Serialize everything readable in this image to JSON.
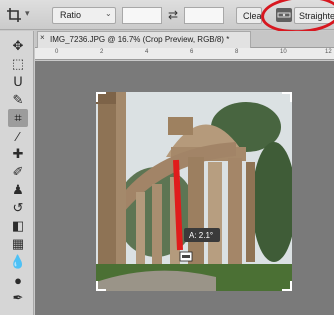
{
  "options_bar": {
    "tool_icon": "crop-icon",
    "ratio_label": "Ratio",
    "swap_icon": "swap-arrows-icon",
    "clear_label": "Clear",
    "straighten_icon": "level-icon",
    "straighten_label": "Straighten",
    "highlight_color": "#d7171f"
  },
  "toolbar": {
    "items": [
      {
        "name": "move-icon",
        "glyph": "✥"
      },
      {
        "name": "marquee-icon",
        "glyph": "⬚"
      },
      {
        "name": "lasso-icon",
        "glyph": "ᑌ"
      },
      {
        "name": "quick-select-icon",
        "glyph": "✎"
      },
      {
        "name": "crop-icon",
        "glyph": "⌗",
        "active": true
      },
      {
        "name": "eyedropper-icon",
        "glyph": "⁄"
      },
      {
        "name": "healing-brush-icon",
        "glyph": "✚"
      },
      {
        "name": "brush-icon",
        "glyph": "✐"
      },
      {
        "name": "clone-stamp-icon",
        "glyph": "♟"
      },
      {
        "name": "history-brush-icon",
        "glyph": "↺"
      },
      {
        "name": "eraser-icon",
        "glyph": "◧"
      },
      {
        "name": "gradient-icon",
        "glyph": "▦"
      },
      {
        "name": "blur-icon",
        "glyph": "💧"
      },
      {
        "name": "dodge-icon",
        "glyph": "●"
      },
      {
        "name": "pen-icon",
        "glyph": "✒"
      }
    ]
  },
  "document": {
    "tab_title": "IMG_7236.JPG @ 16.7% (Crop Preview, RGB/8) *",
    "close_glyph": "×",
    "ruler_ticks": [
      "0",
      "2",
      "4",
      "6",
      "8",
      "10",
      "12"
    ],
    "straighten_readout": "A: 2.1°",
    "straighten_line_color": "#e01c1c"
  }
}
